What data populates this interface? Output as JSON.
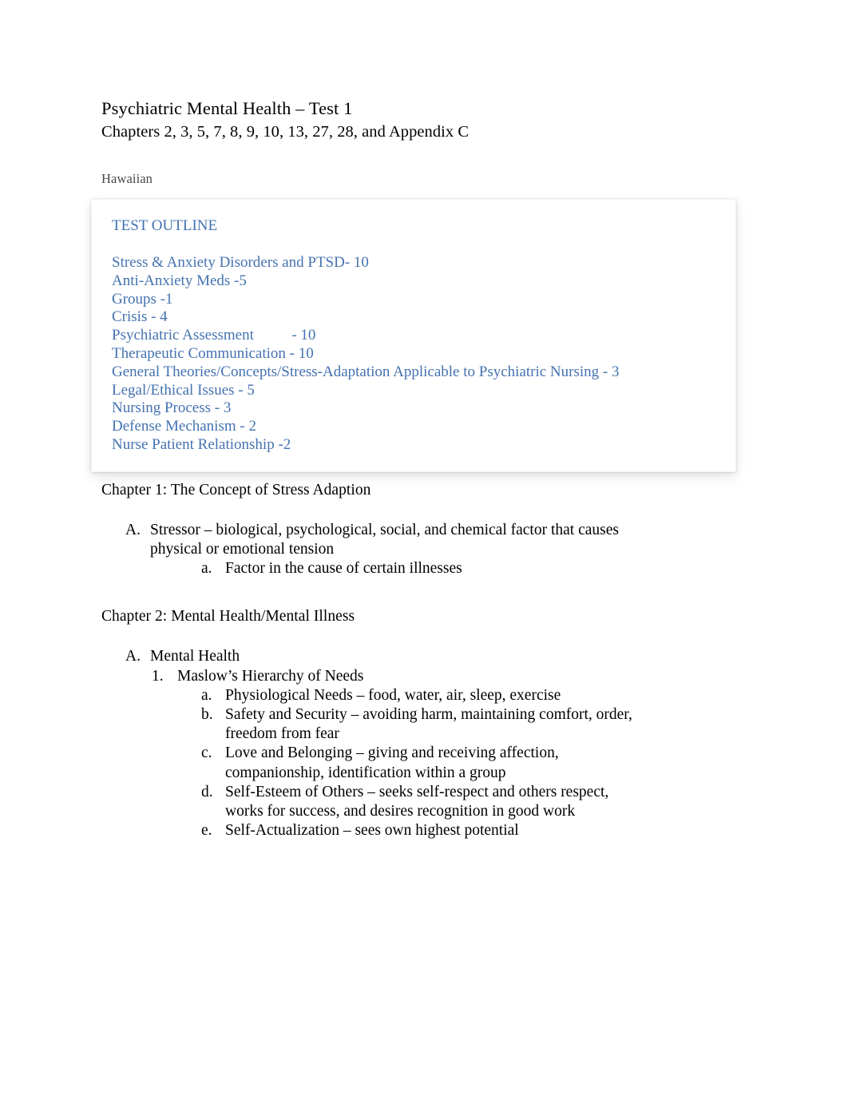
{
  "document": {
    "title": "Psychiatric Mental Health – Test 1",
    "subtitle": "Chapters 2, 3, 5, 7, 8, 9, 10, 13, 27, 28, and Appendix C",
    "tag": "Hawaiian"
  },
  "colors": {
    "outline_text": "#4472b0",
    "body_text": "#000000",
    "tag_text": "#484848",
    "page_background": "#ffffff",
    "box_background": "#ffffff"
  },
  "outline_box": {
    "heading": "TEST OUTLINE",
    "items": [
      "Stress & Anxiety Disorders and PTSD- 10",
      "Anti-Anxiety Meds -5",
      "Groups -1",
      "Crisis - 4",
      "Psychiatric Assessment          - 10",
      "Therapeutic Communication - 10",
      "General Theories/Concepts/Stress-Adaptation Applicable to Psychiatric Nursing - 3",
      "Legal/Ethical Issues - 5",
      "Nursing Process - 3",
      "Defense Mechanism - 2",
      "Nurse Patient Relationship -2"
    ]
  },
  "chapters": [
    {
      "heading": "Chapter 1: The Concept of Stress Adaption",
      "items": [
        {
          "marker": "A.",
          "text": "Stressor – biological, psychological, social, and chemical factor that causes physical or emotional tension",
          "children": [
            {
              "marker": "a.",
              "text": "Factor in the cause of certain illnesses"
            }
          ]
        }
      ]
    },
    {
      "heading": "Chapter 2: Mental Health/Mental Illness",
      "items": [
        {
          "marker": "A.",
          "text": "Mental Health",
          "sub": [
            {
              "marker": "1.",
              "text": "Maslow’s Hierarchy of Needs",
              "children": [
                {
                  "marker": "a.",
                  "text": "Physiological Needs – food, water, air, sleep, exercise"
                },
                {
                  "marker": "b.",
                  "text": "Safety and Security – avoiding harm, maintaining comfort, order, freedom from fear"
                },
                {
                  "marker": "c.",
                  "text": "Love and Belonging – giving and receiving affection, companionship, identification within a group"
                },
                {
                  "marker": "d.",
                  "text": "Self-Esteem of Others – seeks self-respect and others respect, works for success, and desires recognition in good work"
                },
                {
                  "marker": "e.",
                  "text": "Self-Actualization – sees own highest potential"
                }
              ]
            }
          ]
        }
      ]
    }
  ]
}
